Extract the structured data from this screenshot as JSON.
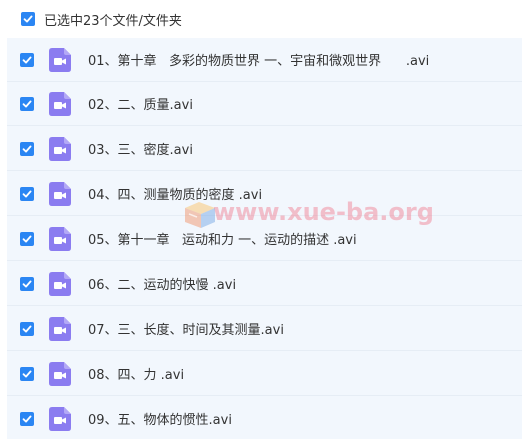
{
  "header": {
    "selection_label": "已选中23个文件/文件夹"
  },
  "files": [
    {
      "name": "01、第十章   多彩的物质世界 一、宇宙和微观世界      .avi",
      "checked": true,
      "icon": "video-file-icon"
    },
    {
      "name": "02、二、质量.avi",
      "checked": true,
      "icon": "video-file-icon"
    },
    {
      "name": "03、三、密度.avi",
      "checked": true,
      "icon": "video-file-icon"
    },
    {
      "name": "04、四、测量物质的密度 .avi",
      "checked": true,
      "icon": "video-file-icon"
    },
    {
      "name": "05、第十一章   运动和力 一、运动的描述 .avi",
      "checked": true,
      "icon": "video-file-icon"
    },
    {
      "name": "06、二、运动的快慢 .avi",
      "checked": true,
      "icon": "video-file-icon"
    },
    {
      "name": "07、三、长度、时间及其测量.avi",
      "checked": true,
      "icon": "video-file-icon"
    },
    {
      "name": "08、四、力 .avi",
      "checked": true,
      "icon": "video-file-icon"
    },
    {
      "name": "09、五、物体的惯性.avi",
      "checked": true,
      "icon": "video-file-icon"
    }
  ],
  "watermark": {
    "text": "www.xue-ba.org"
  },
  "colors": {
    "checkbox": "#2b86f3",
    "file_icon": "#8b7cf0",
    "list_background": "#f2f7fd",
    "watermark": "#f0788c"
  }
}
